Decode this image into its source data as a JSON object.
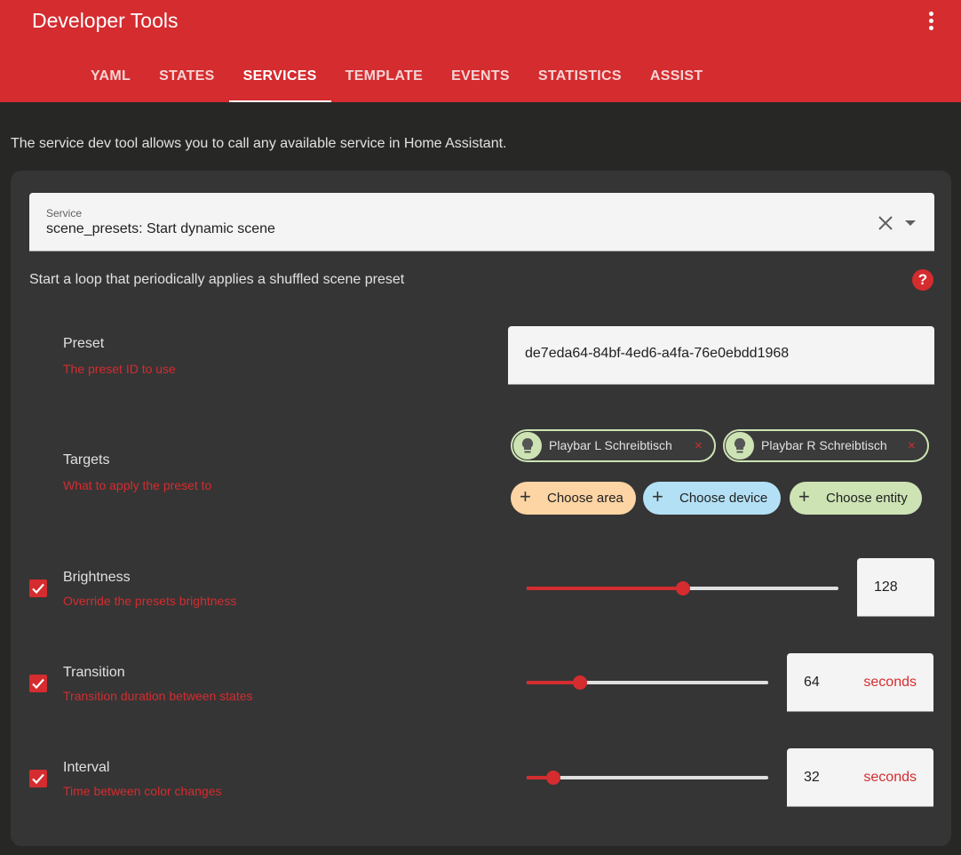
{
  "header": {
    "title": "Developer Tools",
    "tabs": [
      {
        "label": "YAML"
      },
      {
        "label": "STATES"
      },
      {
        "label": "SERVICES"
      },
      {
        "label": "TEMPLATE"
      },
      {
        "label": "EVENTS"
      },
      {
        "label": "STATISTICS"
      },
      {
        "label": "ASSIST"
      }
    ],
    "active_tab": "SERVICES"
  },
  "intro": "The service dev tool allows you to call any available service in Home Assistant.",
  "service": {
    "label": "Service",
    "value": "scene_presets: Start dynamic scene",
    "description": "Start a loop that periodically applies a shuffled scene preset",
    "help": "?"
  },
  "fields": {
    "preset": {
      "name": "Preset",
      "description": "The preset ID to use",
      "value": "de7eda64-84bf-4ed6-a4fa-76e0ebdd1968"
    },
    "targets": {
      "name": "Targets",
      "description": "What to apply the preset to",
      "chips": [
        {
          "label": "Playbar L Schreibtisch",
          "remove": "×"
        },
        {
          "label": "Playbar R Schreibtisch",
          "remove": "×"
        }
      ],
      "pickers": [
        {
          "label": "Choose area",
          "icon": "+",
          "color": "#fdd4a4"
        },
        {
          "label": "Choose device",
          "icon": "+",
          "color": "#b3e0f5"
        },
        {
          "label": "Choose entity",
          "icon": "+",
          "color": "#cde3b4"
        }
      ]
    },
    "brightness": {
      "name": "Brightness",
      "description": "Override the presets brightness",
      "checked": true,
      "value": "128",
      "slider_fraction": 0.5
    },
    "transition": {
      "name": "Transition",
      "description": "Transition duration between states",
      "checked": true,
      "value": "64",
      "unit": "seconds",
      "slider_fraction": 0.22
    },
    "interval": {
      "name": "Interval",
      "description": "Time between color changes",
      "checked": true,
      "value": "32",
      "unit": "seconds",
      "slider_fraction": 0.11
    }
  },
  "colors": {
    "accent": "#d42c2f",
    "background": "#272826",
    "card": "#353535"
  }
}
